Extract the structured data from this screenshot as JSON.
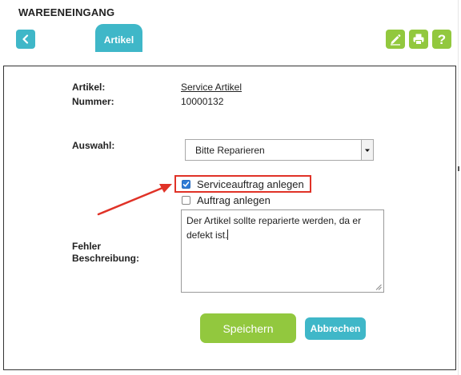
{
  "header": {
    "title": "WAREENEINGANG",
    "tab_label": "Artikel",
    "back_icon": "chevron-left-icon",
    "toolbar_icons": [
      "pencil-icon",
      "printer-icon",
      "help-icon"
    ],
    "help_glyph": "?"
  },
  "article": {
    "artikel_label": "Artikel:",
    "artikel_value": "Service Artikel",
    "nummer_label": "Nummer:",
    "nummer_value": "10000132"
  },
  "form": {
    "auswahl_label": "Auswahl:",
    "auswahl_selected": "Bitte Reparieren",
    "checkbox_service_label": "Serviceauftrag anlegen",
    "checkbox_service_checked": true,
    "checkbox_auftrag_label": "Auftrag anlegen",
    "checkbox_auftrag_checked": false,
    "fehler_label_line1": "Fehler",
    "fehler_label_line2": "Beschreibung:",
    "fehler_text": "Der Artikel sollte reparierte werden, da er defekt ist."
  },
  "buttons": {
    "save_label": "Speichern",
    "cancel_label": "Abbrechen"
  },
  "colors": {
    "accent_teal": "#3fb7c8",
    "accent_green": "#92c83e",
    "annotation_red": "#e03227",
    "checkbox_blue": "#2d7bd6"
  }
}
